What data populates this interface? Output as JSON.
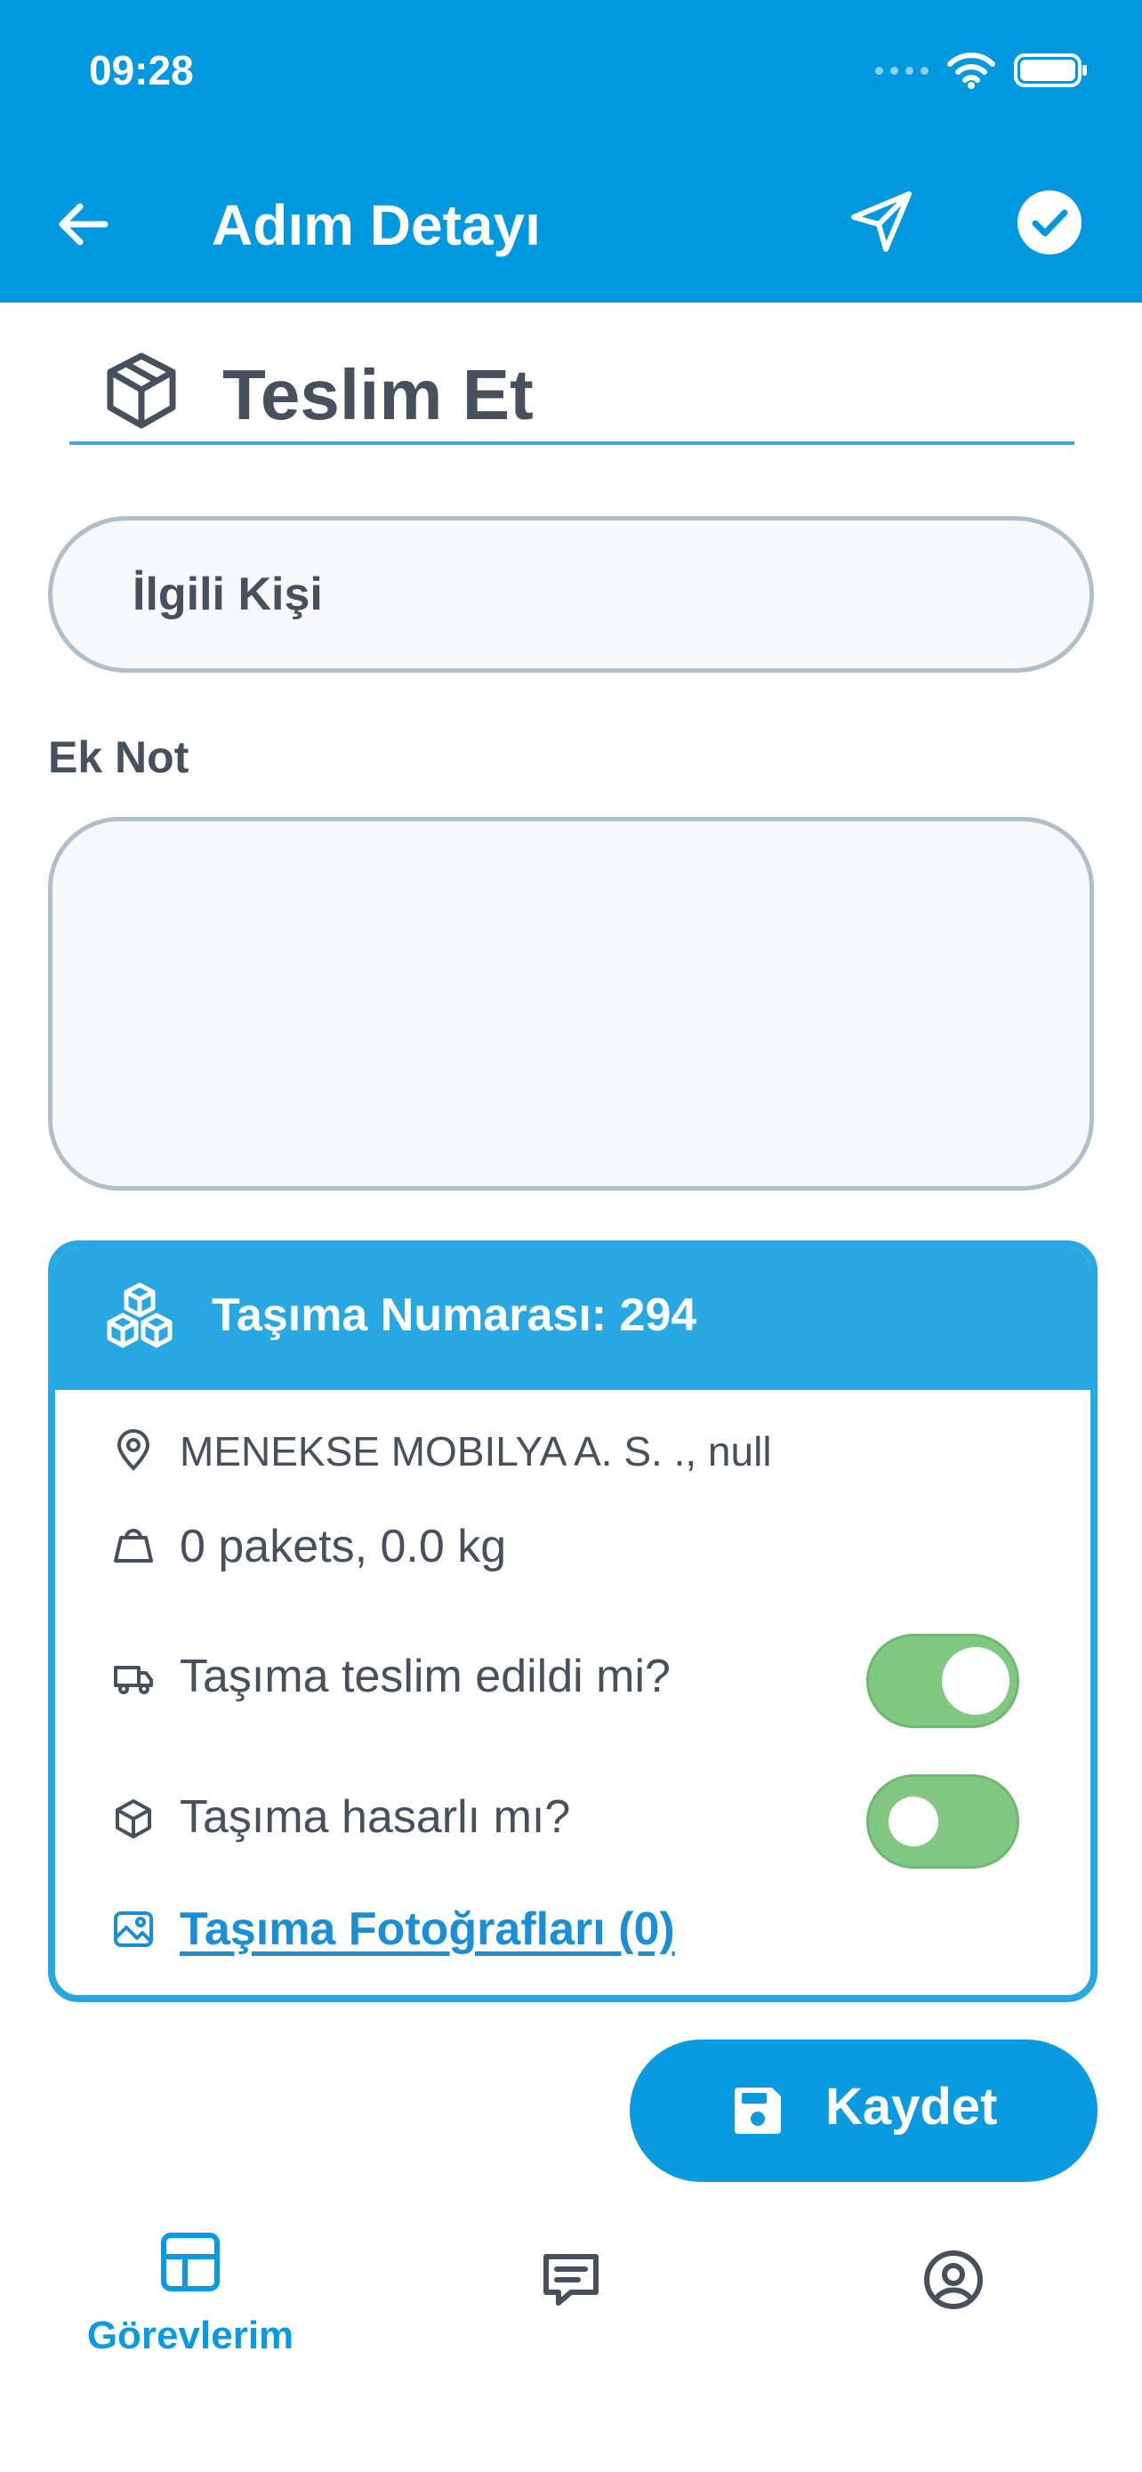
{
  "status_bar": {
    "time": "09:28"
  },
  "header": {
    "title": "Adım Detayı"
  },
  "step": {
    "title": "Teslim Et"
  },
  "form": {
    "contact_placeholder": "İlgili Kişi",
    "note_label": "Ek Not",
    "note_value": ""
  },
  "transport": {
    "title": "Taşıma Numarası: 294",
    "address": "MENEKSE MOBILYA A. S. ., null",
    "package_info": "0 pakets, 0.0 kg",
    "delivered_question": "Taşıma teslim edildi mi?",
    "delivered_on": true,
    "damaged_question": "Taşıma hasarlı mı?",
    "damaged_on": false,
    "photos_link": "Taşıma Fotoğrafları (0)"
  },
  "actions": {
    "save_label": "Kaydet"
  },
  "bottom_nav": {
    "items": [
      {
        "label": "Görevlerim",
        "icon": "grid-icon",
        "active": true
      },
      {
        "label": "",
        "icon": "chat-icon",
        "active": false
      },
      {
        "label": "",
        "icon": "profile-icon",
        "active": false
      }
    ]
  },
  "colors": {
    "primary": "#0099df",
    "card_accent": "#28a8e2",
    "toggle_green": "#82c782",
    "text_dark": "#47505d",
    "link_blue": "#1a8fd6"
  }
}
